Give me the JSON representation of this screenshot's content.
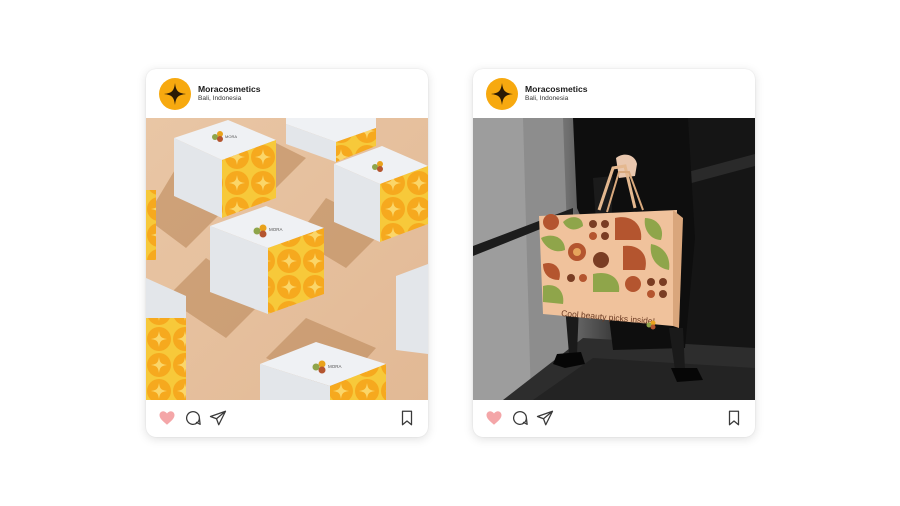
{
  "posts": [
    {
      "account": {
        "name": "Moracosmetics",
        "location": "Bali, Indonesia",
        "avatar_icon": "four-point-star-icon",
        "avatar_color": "#F7A90F"
      },
      "image": {
        "subject": "boxes",
        "brand_text": "MORA",
        "colors": {
          "background": "#E8C3A1",
          "box": "#ECEEF1",
          "pattern": "#F6B323"
        }
      },
      "actions": {
        "like_icon": "heart-icon",
        "comment_icon": "comment-icon",
        "share_icon": "send-icon",
        "save_icon": "bookmark-icon",
        "like_color": "#F4A6A8"
      }
    },
    {
      "account": {
        "name": "Moracosmetics",
        "location": "Bali, Indonesia",
        "avatar_icon": "four-point-star-icon",
        "avatar_color": "#F7A90F"
      },
      "image": {
        "subject": "shopping-bag",
        "bag_text": "Cool beauty picks inside!",
        "colors": {
          "background": "#2A2A2A",
          "bag": "#F0C29C",
          "pattern_green": "#8FA54A",
          "pattern_rust": "#B4552F"
        }
      },
      "actions": {
        "like_icon": "heart-icon",
        "comment_icon": "comment-icon",
        "share_icon": "send-icon",
        "save_icon": "bookmark-icon",
        "like_color": "#F4A6A8"
      }
    }
  ]
}
